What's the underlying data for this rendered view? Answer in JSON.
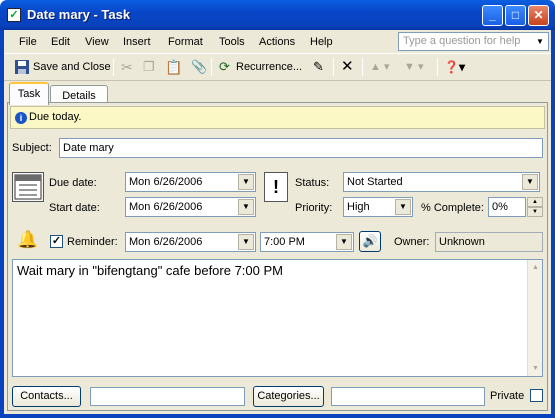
{
  "window": {
    "title": "Date mary - Task"
  },
  "menu": {
    "items": [
      "File",
      "Edit",
      "View",
      "Insert",
      "Format",
      "Tools",
      "Actions",
      "Help"
    ],
    "help_placeholder": "Type a question for help"
  },
  "toolbar": {
    "save_close": "Save and Close",
    "recurrence": "Recurrence..."
  },
  "tabs": [
    "Task",
    "Details"
  ],
  "info": {
    "text": "Due today."
  },
  "form": {
    "subject_label": "Subject:",
    "subject_value": "Date mary",
    "due_label": "Due date:",
    "due_value": "Mon 6/26/2006",
    "start_label": "Start date:",
    "start_value": "Mon 6/26/2006",
    "status_label": "Status:",
    "status_value": "Not Started",
    "priority_label": "Priority:",
    "priority_value": "High",
    "complete_label": "% Complete:",
    "complete_value": "0%",
    "reminder_label": "Reminder:",
    "reminder_checked": true,
    "reminder_date": "Mon 6/26/2006",
    "reminder_time": "7:00 PM",
    "owner_label": "Owner:",
    "owner_value": "Unknown"
  },
  "notes": {
    "text": "Wait mary in \"bifengtang\" cafe before 7:00 PM"
  },
  "footer": {
    "contacts": "Contacts...",
    "contacts_value": "",
    "categories": "Categories...",
    "categories_value": "",
    "private_label": "Private"
  }
}
